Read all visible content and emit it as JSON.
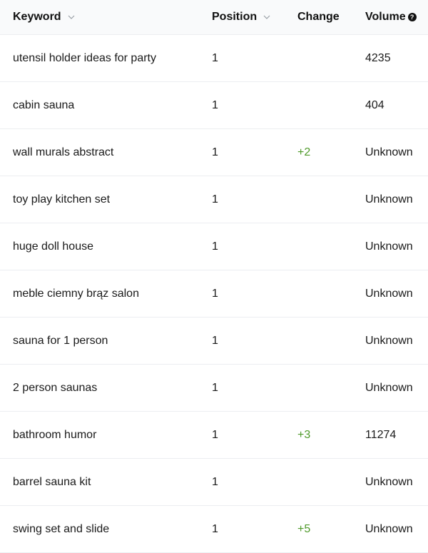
{
  "header": {
    "keyword": "Keyword",
    "position": "Position",
    "change": "Change",
    "volume": "Volume",
    "volume_help_icon": "question-circle-icon",
    "sort_icon": "chevron-down-icon"
  },
  "colors": {
    "positive_change": "#4f9a2a",
    "header_bg": "#f9fafb",
    "divider": "#eceef1"
  },
  "rows": [
    {
      "keyword": "utensil holder ideas for party",
      "position": "1",
      "change": "",
      "volume": "4235"
    },
    {
      "keyword": "cabin sauna",
      "position": "1",
      "change": "",
      "volume": "404"
    },
    {
      "keyword": "wall murals abstract",
      "position": "1",
      "change": "+2",
      "volume": "Unknown"
    },
    {
      "keyword": "toy play kitchen set",
      "position": "1",
      "change": "",
      "volume": "Unknown"
    },
    {
      "keyword": "huge doll house",
      "position": "1",
      "change": "",
      "volume": "Unknown"
    },
    {
      "keyword": "meble ciemny brąz salon",
      "position": "1",
      "change": "",
      "volume": "Unknown"
    },
    {
      "keyword": "sauna for 1 person",
      "position": "1",
      "change": "",
      "volume": "Unknown"
    },
    {
      "keyword": "2 person saunas",
      "position": "1",
      "change": "",
      "volume": "Unknown"
    },
    {
      "keyword": "bathroom humor",
      "position": "1",
      "change": "+3",
      "volume": "11274"
    },
    {
      "keyword": "barrel sauna kit",
      "position": "1",
      "change": "",
      "volume": "Unknown"
    },
    {
      "keyword": "swing set and slide",
      "position": "1",
      "change": "+5",
      "volume": "Unknown"
    }
  ]
}
